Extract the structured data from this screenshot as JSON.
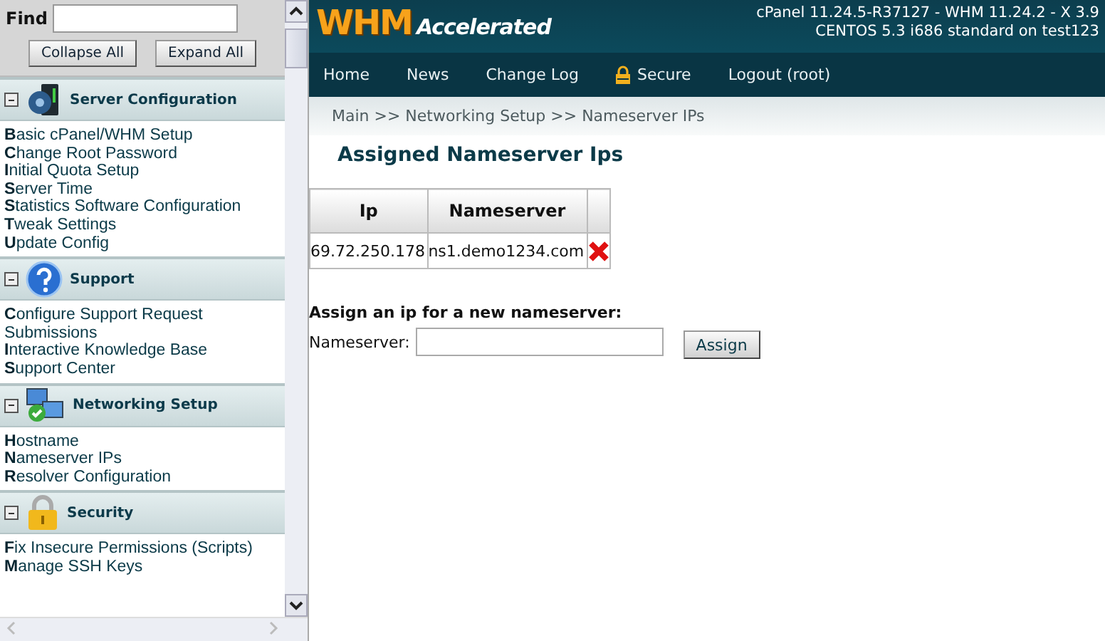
{
  "sidebar": {
    "find_label": "Find",
    "buttons": [
      "Collapse All",
      "Expand All"
    ],
    "sections": [
      {
        "title": "Server Configuration",
        "kind": "server",
        "expanded": true,
        "links": [
          "**B**asic cPanel/WHM Setup",
          "**C**hange Root Password",
          "**I**nitial Quota Setup",
          "**S**erver Time",
          "**S**tatistics Software Configuration",
          "**T**weak Settings",
          "**U**pdate Config"
        ]
      },
      {
        "title": "Support",
        "kind": "support",
        "expanded": true,
        "links": [
          "**C**onfigure Support Request Submissions",
          "**I**nteractive Knowledge Base",
          "**S**upport Center"
        ]
      },
      {
        "title": "Networking Setup",
        "kind": "network",
        "expanded": true,
        "links": [
          "**H**ostname",
          "**N**ameserver IPs",
          "**R**esolver Configuration"
        ]
      },
      {
        "title": "Security",
        "kind": "security",
        "expanded": true,
        "links": [
          "**F**ix Insecure Permissions (Scripts)",
          "**M**anage SSH Keys"
        ]
      }
    ]
  },
  "header": {
    "logo_main": "WHM",
    "logo_sub": "Accelerated",
    "version_lines": [
      "cPanel 11.24.5-R37127 - WHM 11.24.2 - X 3.9",
      "CENTOS 5.3 i686 standard on test123"
    ],
    "nav": [
      {
        "label": "Home",
        "kind": "plain"
      },
      {
        "label": "News",
        "kind": "plain"
      },
      {
        "label": "Change Log",
        "kind": "plain"
      },
      {
        "label": "Secure",
        "kind": "lock"
      },
      {
        "label": "Logout (root)",
        "kind": "plain"
      }
    ],
    "breadcrumb": "Main >> Networking Setup >> Nameserver IPs"
  },
  "main": {
    "title": "Assigned Nameserver Ips",
    "table": {
      "columns": [
        "Ip",
        "Nameserver"
      ],
      "rows": [
        {
          "ip": "69.72.250.178",
          "nameserver": "ns1.demo1234.com"
        }
      ]
    },
    "form": {
      "heading": "Assign an ip for a new nameserver:",
      "field_label": "Nameserver:",
      "button": "Assign"
    }
  }
}
